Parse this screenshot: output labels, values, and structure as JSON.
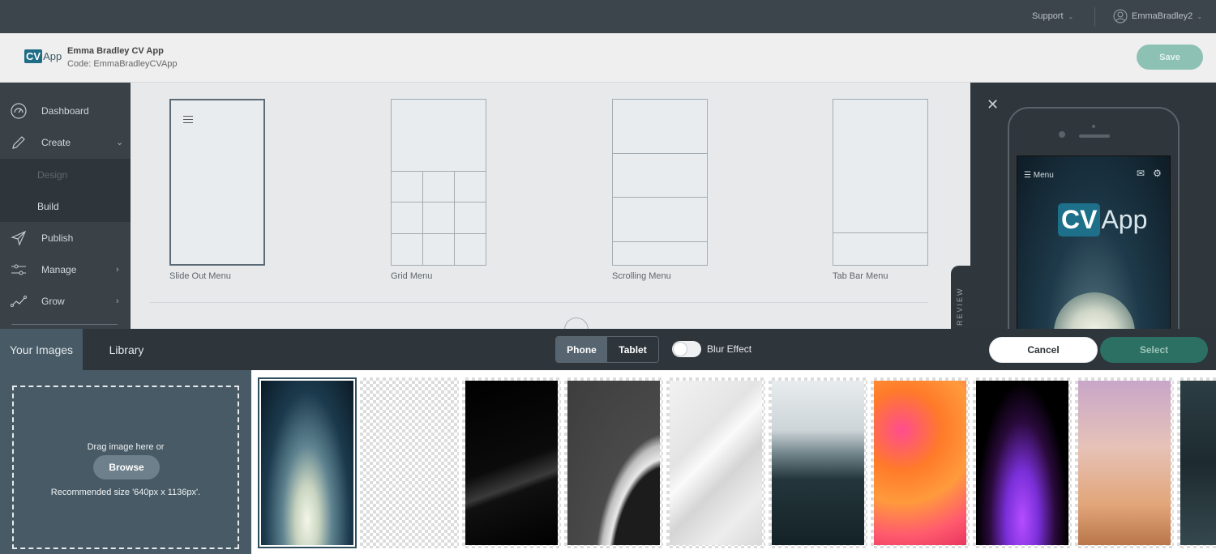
{
  "topbar": {
    "support_label": "Support",
    "username": "EmmaBradley2"
  },
  "app": {
    "logo_cv": "CV",
    "logo_app": "App",
    "title": "Emma Bradley CV App",
    "code": "Code: EmmaBradleyCVApp",
    "save_label": "Save"
  },
  "sidebar": {
    "dashboard": "Dashboard",
    "create": "Create",
    "design": "Design",
    "build": "Build",
    "publish": "Publish",
    "manage": "Manage",
    "grow": "Grow"
  },
  "menus": [
    {
      "label": "Slide Out Menu",
      "selected": true
    },
    {
      "label": "Grid Menu",
      "selected": false
    },
    {
      "label": "Scrolling Menu",
      "selected": false
    },
    {
      "label": "Tab Bar Menu",
      "selected": false
    }
  ],
  "preview": {
    "tab_label": "REVIEW",
    "menu_label": "Menu",
    "logo_cv": "CV",
    "logo_app": "App"
  },
  "picker": {
    "tab_your_images": "Your Images",
    "tab_library": "Library",
    "device_phone": "Phone",
    "device_tablet": "Tablet",
    "blur_label": "Blur Effect",
    "blur_on": false,
    "cancel_label": "Cancel",
    "select_label": "Select"
  },
  "upload": {
    "drag_text": "Drag image here or",
    "browse_label": "Browse",
    "recommended": "Recommended size '640px x 1136px'."
  },
  "thumbnails": [
    {
      "name": "lightbulb",
      "selected": true
    },
    {
      "name": "transparent",
      "selected": false
    },
    {
      "name": "dark-laptop",
      "selected": false
    },
    {
      "name": "gray-curve",
      "selected": false
    },
    {
      "name": "white-diagonal",
      "selected": false
    },
    {
      "name": "mountain-road",
      "selected": false
    },
    {
      "name": "orange-smoke",
      "selected": false
    },
    {
      "name": "purple-ink",
      "selected": false
    },
    {
      "name": "pink-gradient",
      "selected": false
    },
    {
      "name": "dark-stone",
      "selected": false
    }
  ],
  "colors": {
    "accent": "#2b7062",
    "sidebar": "#3a4248",
    "topbar": "#3d454c",
    "panel_blue": "#475a66"
  }
}
